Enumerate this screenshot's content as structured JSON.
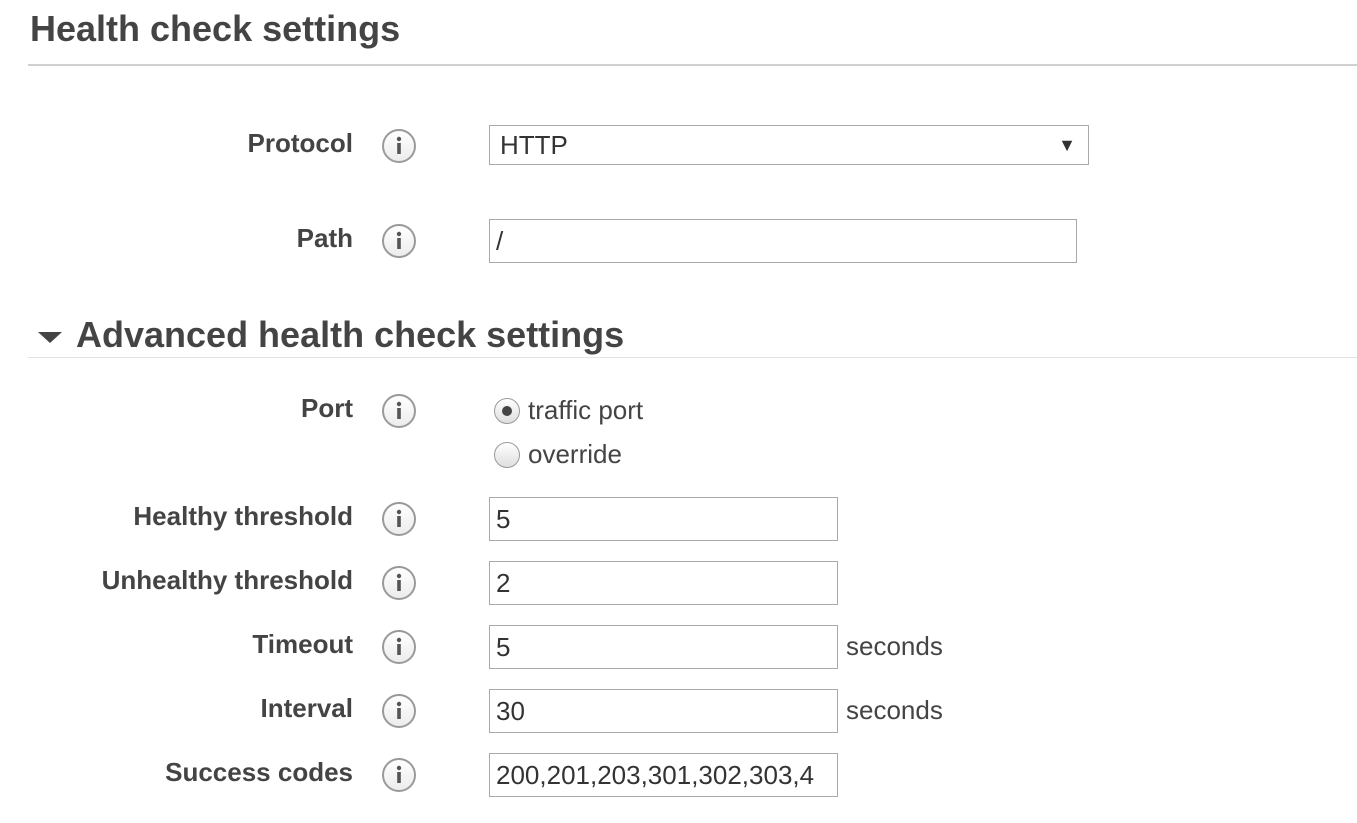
{
  "health_check": {
    "title": "Health check settings",
    "protocol": {
      "label": "Protocol",
      "value": "HTTP"
    },
    "path": {
      "label": "Path",
      "value": "/"
    }
  },
  "advanced": {
    "title": "Advanced health check settings",
    "port": {
      "label": "Port",
      "options": [
        {
          "label": "traffic port",
          "selected": true
        },
        {
          "label": "override",
          "selected": false
        }
      ]
    },
    "healthy_threshold": {
      "label": "Healthy threshold",
      "value": "5"
    },
    "unhealthy_threshold": {
      "label": "Unhealthy threshold",
      "value": "2"
    },
    "timeout": {
      "label": "Timeout",
      "value": "5",
      "unit": "seconds"
    },
    "interval": {
      "label": "Interval",
      "value": "30",
      "unit": "seconds"
    },
    "success_codes": {
      "label": "Success codes",
      "value": "200,201,203,301,302,303,4"
    }
  },
  "icons": {
    "info": "info-icon",
    "caret": "caret-down-icon",
    "dropdown": "dropdown-arrow-icon"
  },
  "colors": {
    "text": "#444444",
    "border": "#a9a9a9",
    "rule": "#d0d0d0"
  }
}
